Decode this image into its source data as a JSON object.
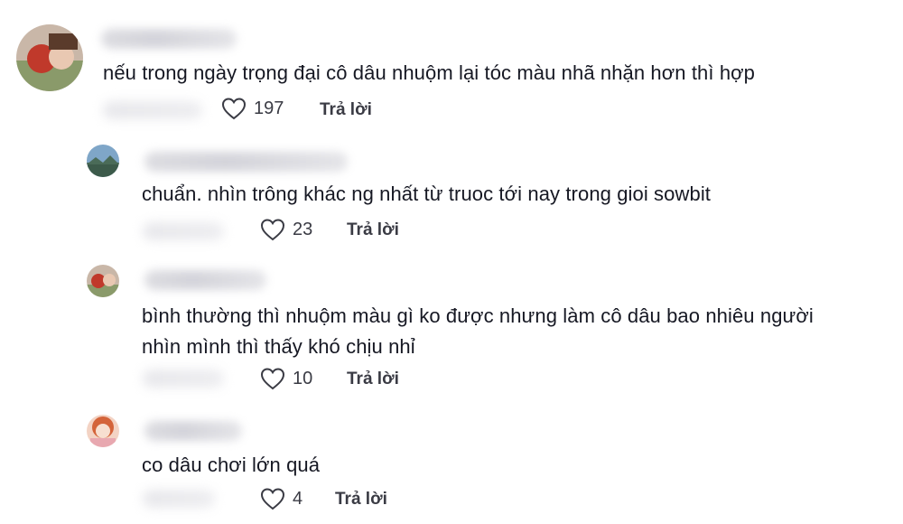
{
  "comments": [
    {
      "text": "nếu trong ngày trọng đại cô dâu nhuộm lại tóc màu nhã nhặn hơn thì hợp",
      "likes": "197",
      "reply_label": "Trả lời",
      "avatar_icon": "user-avatar-icon"
    },
    {
      "text": "chuẩn. nhìn trông khác ng nhất từ truoc tới nay trong gioi sowbit",
      "likes": "23",
      "reply_label": "Trả lời",
      "avatar_icon": "user-avatar-icon"
    },
    {
      "text": "bình thường thì nhuộm màu gì ko được nhưng làm cô dâu bao nhiêu người nhìn mình thì thấy khó chịu nhỉ",
      "text_line1": "bình thường thì nhuộm màu gì ko được nhưng làm cô dâu bao nhiêu người",
      "text_line2": "nhìn mình thì thấy khó chịu nhỉ",
      "likes": "10",
      "reply_label": "Trả lời",
      "avatar_icon": "user-avatar-icon"
    },
    {
      "text": "co dâu chơi lớn quá",
      "likes": "4",
      "reply_label": "Trả lời",
      "avatar_icon": "user-avatar-icon"
    }
  ],
  "icons": {
    "like": "heart-outline-icon"
  },
  "colors": {
    "text": "#161823",
    "meta": "#3a3b44",
    "heart_stroke": "#3a3b44"
  }
}
